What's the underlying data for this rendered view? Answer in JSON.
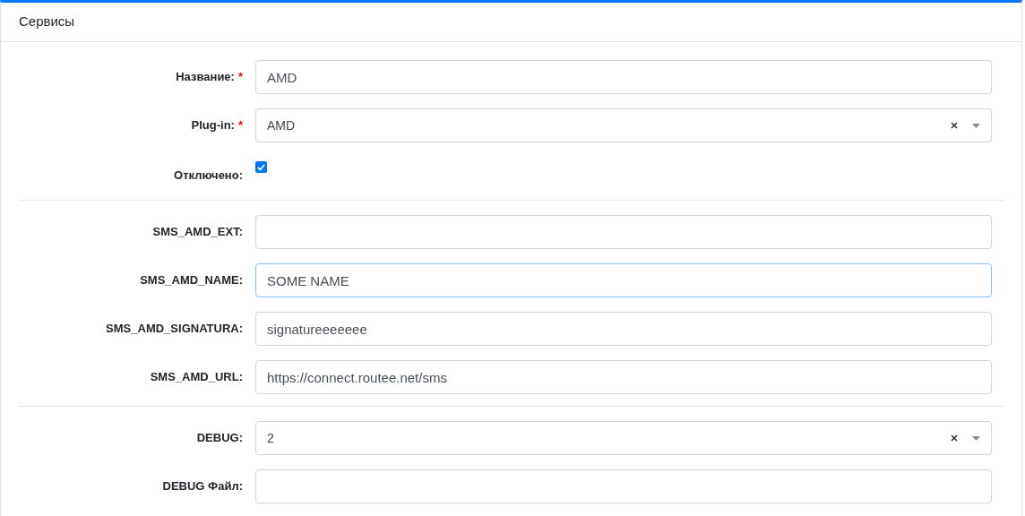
{
  "card": {
    "title": "Сервисы"
  },
  "groups": [
    {
      "fields": [
        {
          "kind": "text",
          "label": "Название:",
          "required_mark": "*",
          "value": "AMD",
          "focused": false
        },
        {
          "kind": "select",
          "label": "Plug-in:",
          "required_mark": "*",
          "value": "AMD",
          "focused": false
        },
        {
          "kind": "checkbox",
          "label": "Отключено:",
          "checked": true
        }
      ]
    },
    {
      "fields": [
        {
          "kind": "text",
          "label": "SMS_AMD_EXT:",
          "focused": false
        },
        {
          "kind": "text",
          "label": "SMS_AMD_NAME:",
          "value": "SOME NAME",
          "focused": true
        },
        {
          "kind": "text",
          "label": "SMS_AMD_SIGNATURA:",
          "value": "signatureeeeeee",
          "focused": false
        },
        {
          "kind": "text",
          "label": "SMS_AMD_URL:",
          "value": "https://connect.routee.net/sms",
          "focused": false
        }
      ]
    },
    {
      "fields": [
        {
          "kind": "select",
          "label": "DEBUG:",
          "value": "2",
          "focused": false
        },
        {
          "kind": "text",
          "label": "DEBUG Файл:",
          "focused": false
        }
      ]
    }
  ]
}
